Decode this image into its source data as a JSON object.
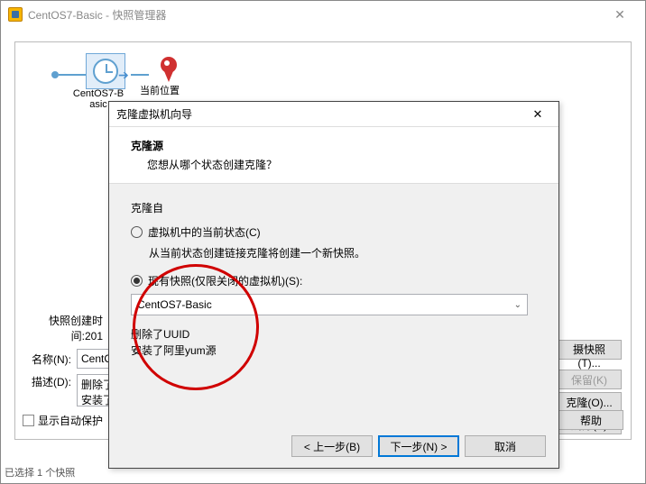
{
  "main": {
    "title": "CentOS7-Basic - 快照管理器",
    "snapshot1": "CentOS7-B\nasic",
    "snapshot2": "当前位置",
    "created_label": "快照创建时间:201",
    "name_label": "名称(N):",
    "name_value": "CentOS",
    "desc_label": "描述(D):",
    "desc_value": "删除了\n安装了",
    "btn_take": "摄快照(T)...",
    "btn_keep": "保留(K)",
    "btn_clone": "克隆(O)...",
    "btn_delete": "删除(E)",
    "autoprotect_label": "显示自动保护",
    "help": "帮助",
    "status": "已选择 1 个快照"
  },
  "dialog": {
    "title": "克隆虚拟机向导",
    "heading": "克隆源",
    "subheading": "您想从哪个状态创建克隆？",
    "clone_from": "克隆自",
    "radio_current": "虚拟机中的当前状态(C)",
    "current_note": "从当前状态创建链接克隆将创建一个新快照。",
    "radio_snapshot": "现有快照(仅限关闭的虚拟机)(S):",
    "select_value": "CentOS7-Basic",
    "snapshot_desc": "删除了UUID\n安装了阿里yum源",
    "btn_back": "< 上一步(B)",
    "btn_next": "下一步(N) >",
    "btn_cancel": "取消"
  }
}
